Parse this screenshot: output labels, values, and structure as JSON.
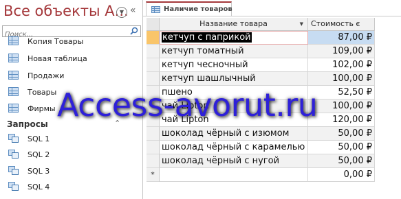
{
  "nav": {
    "title": "Все объекты А...",
    "search_placeholder": "Поиск...",
    "tables": [
      {
        "label": "Копия Товары"
      },
      {
        "label": "Новая таблица"
      },
      {
        "label": "Продажи"
      },
      {
        "label": "Товары"
      },
      {
        "label": "Фирмы"
      }
    ],
    "queries_section": "Запросы",
    "queries": [
      {
        "label": "SQL 1"
      },
      {
        "label": "SQL 2"
      },
      {
        "label": "SQL 3"
      },
      {
        "label": "SQL 4"
      }
    ]
  },
  "tab": {
    "label": "Наличие товаров"
  },
  "datasheet": {
    "columns": [
      "Название товара",
      "Стоимость є"
    ],
    "rows": [
      {
        "name": "кетчуп с паприкой",
        "price": "87,00 ₽"
      },
      {
        "name": "кетчуп томатный",
        "price": "109,00 ₽"
      },
      {
        "name": "кетчуп чесночный",
        "price": "102,00 ₽"
      },
      {
        "name": "кетчуп шашлычный",
        "price": "100,00 ₽"
      },
      {
        "name": "пшено",
        "price": "52,50 ₽"
      },
      {
        "name": "чай Lipton",
        "price": "100,00 ₽"
      },
      {
        "name": "чай Lipton",
        "price": "120,00 ₽"
      },
      {
        "name": "шоколад чёрный с изюмом",
        "price": "50,00 ₽"
      },
      {
        "name": "шоколад чёрный с карамелью",
        "price": "50,00 ₽"
      },
      {
        "name": "шоколад чёрный с нугой",
        "price": "50,00 ₽"
      }
    ],
    "new_row_marker": "*",
    "new_row_price": "0,00 ₽"
  },
  "watermark": "Access-avorut.ru",
  "colors": {
    "accent": "#a4373a",
    "current_row": "#f9c56a",
    "selected_cell": "#c7dcf2",
    "watermark": "#2e20d8"
  }
}
